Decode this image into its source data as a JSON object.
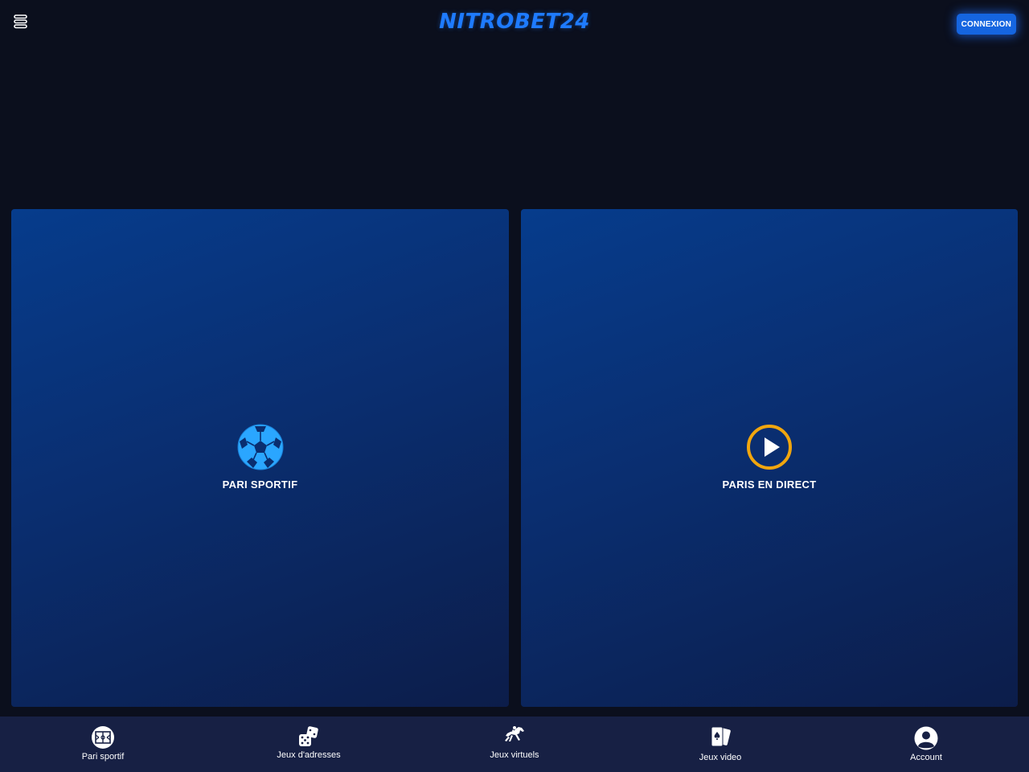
{
  "header": {
    "menu_icon": "menu-icon",
    "logo_text": "NITROBET24",
    "login_label": "CONNEXION"
  },
  "colors": {
    "background": "#0b0f1d",
    "accent": "#1e7bff",
    "card_gradient_start": "#063c8c",
    "card_gradient_end": "#0c1d4a",
    "bottom_nav": "#172044",
    "live_ring": "#f1a60e"
  },
  "cards": [
    {
      "label": "PARI SPORTIF",
      "icon": "soccer-ball-icon"
    },
    {
      "label": "PARIS EN DIRECT",
      "icon": "play-circle-icon"
    }
  ],
  "bottom_nav": {
    "items": [
      {
        "label": "Pari sportif",
        "icon": "stadium-icon"
      },
      {
        "label": "Jeux d'adresses",
        "icon": "dice-icon"
      },
      {
        "label": "Jeux virtuels",
        "icon": "horse-racing-icon"
      },
      {
        "label": "Jeux video",
        "icon": "playing-cards-icon"
      },
      {
        "label": "Account",
        "icon": "user-icon"
      }
    ]
  }
}
